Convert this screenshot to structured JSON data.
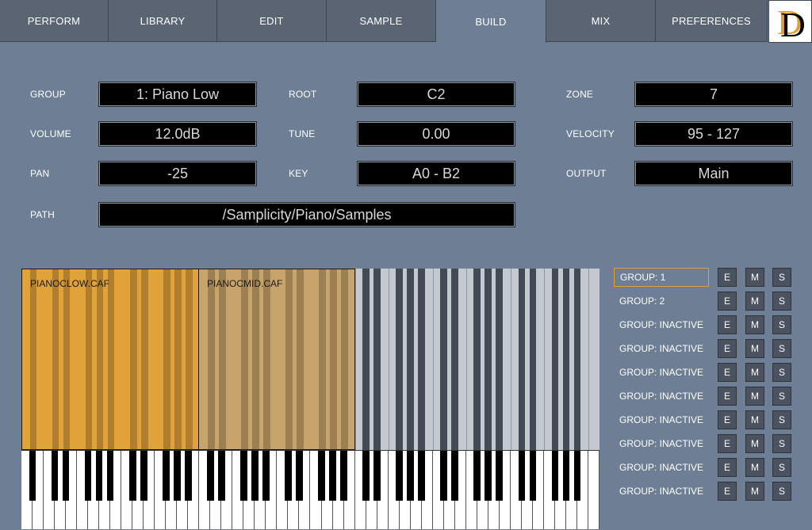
{
  "tabs": [
    {
      "label": "PERFORM",
      "active": false
    },
    {
      "label": "LIBRARY",
      "active": false
    },
    {
      "label": "EDIT",
      "active": false
    },
    {
      "label": "SAMPLE",
      "active": false
    },
    {
      "label": "BUILD",
      "active": true
    },
    {
      "label": "MIX",
      "active": false
    },
    {
      "label": "PREFERENCES",
      "active": false
    }
  ],
  "logo": {
    "letters": "D",
    "colors": [
      "#e0a030",
      "#000000"
    ]
  },
  "params": {
    "group_label": "GROUP",
    "group_value": "1: Piano Low",
    "volume_label": "VOLUME",
    "volume_value": "12.0dB",
    "pan_label": "PAN",
    "pan_value": "-25",
    "path_label": "PATH",
    "path_value": "/Samplicity/Piano/Samples",
    "root_label": "ROOT",
    "root_value": "C2",
    "tune_label": "TUNE",
    "tune_value": "0.00",
    "key_label": "KEY",
    "key_value": "A0 - B2",
    "zone_label": "ZONE",
    "zone_value": "7",
    "velocity_label": "VELOCITY",
    "velocity_value": "95 - 127",
    "output_label": "OUTPUT",
    "output_value": "Main"
  },
  "zones": [
    {
      "name": "PIANOCLOW.CAF",
      "color": "#e2a23a"
    },
    {
      "name": "PIANOCMID.CAF",
      "color": "#c9a46a"
    }
  ],
  "groups": [
    {
      "label": "GROUP: 1",
      "selected": true
    },
    {
      "label": "GROUP: 2",
      "selected": false
    },
    {
      "label": "GROUP: INACTIVE",
      "selected": false
    },
    {
      "label": "GROUP: INACTIVE",
      "selected": false
    },
    {
      "label": "GROUP: INACTIVE",
      "selected": false
    },
    {
      "label": "GROUP: INACTIVE",
      "selected": false
    },
    {
      "label": "GROUP: INACTIVE",
      "selected": false
    },
    {
      "label": "GROUP: INACTIVE",
      "selected": false
    },
    {
      "label": "GROUP: INACTIVE",
      "selected": false
    },
    {
      "label": "GROUP: INACTIVE",
      "selected": false
    }
  ],
  "group_buttons": {
    "edit": "E",
    "mute": "M",
    "solo": "S"
  }
}
